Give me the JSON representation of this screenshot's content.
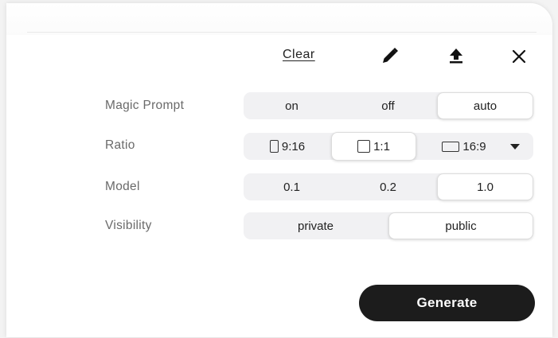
{
  "toolbar": {
    "clear_label": "Clear",
    "icons": [
      "pen-icon",
      "upload-icon",
      "close-icon"
    ]
  },
  "settings": {
    "magic_prompt": {
      "label": "Magic Prompt",
      "options": [
        "on",
        "off",
        "auto"
      ],
      "selected": "auto"
    },
    "ratio": {
      "label": "Ratio",
      "options": [
        "9:16",
        "1:1",
        "16:9"
      ],
      "selected": "1:1"
    },
    "model": {
      "label": "Model",
      "options": [
        "0.1",
        "0.2",
        "1.0"
      ],
      "selected": "1.0"
    },
    "visibility": {
      "label": "Visibility",
      "options": [
        "private",
        "public"
      ],
      "selected": "public"
    }
  },
  "generate_label": "Generate",
  "colors": {
    "button_bg": "#1c1c1c",
    "segment_bg": "#f1f1f3",
    "label_text": "#6a6a6a"
  }
}
